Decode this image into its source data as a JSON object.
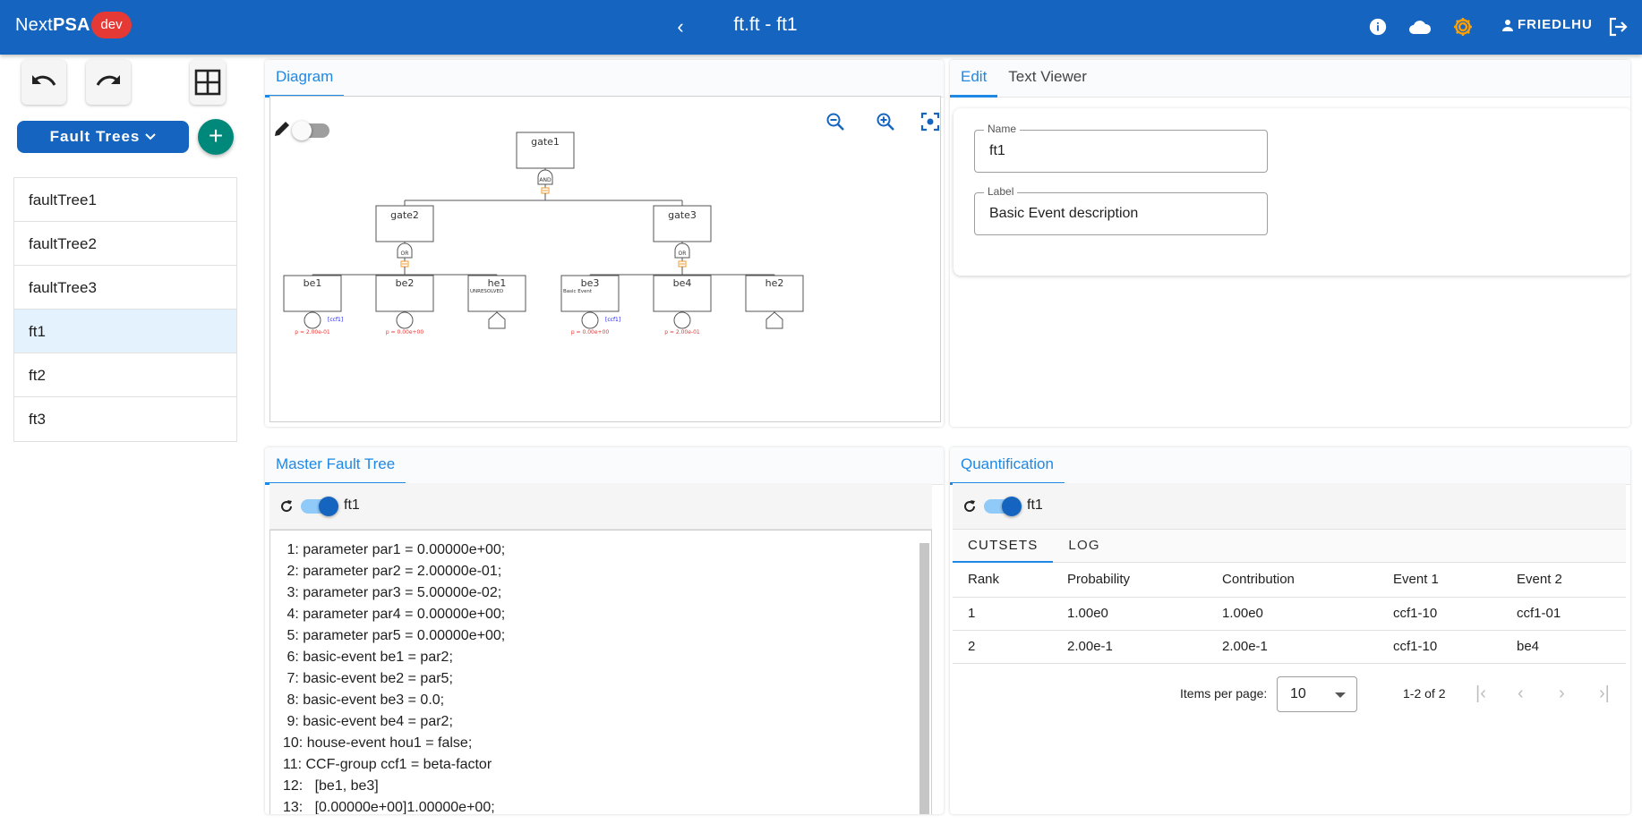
{
  "header": {
    "brand_prefix": "Next",
    "brand_suffix": "PSA",
    "env_badge": "dev",
    "title": "ft.ft - ft1",
    "user": "FRIEDLHU"
  },
  "sidebar": {
    "dropdown_label": "Fault Trees",
    "items": [
      "faultTree1",
      "faultTree2",
      "faultTree3",
      "ft1",
      "ft2",
      "ft3"
    ],
    "selected": "ft1"
  },
  "diagram_panel": {
    "tab": "Diagram",
    "tree": {
      "top": {
        "name": "gate1",
        "type": "AND"
      },
      "gates": [
        {
          "name": "gate2",
          "type": "OR"
        },
        {
          "name": "gate3",
          "type": "OR"
        }
      ],
      "events": [
        {
          "name": "be1",
          "kind": "basic",
          "prob": "p = 2.00e-01",
          "tag": "[ccf1]",
          "desc": ""
        },
        {
          "name": "be2",
          "kind": "basic",
          "prob": "p = 0.00e+00",
          "tag": "",
          "desc": ""
        },
        {
          "name": "he1",
          "kind": "house",
          "prob": "",
          "tag": "",
          "desc": "UNRESOLVED"
        },
        {
          "name": "be3",
          "kind": "basic",
          "prob": "p = 0.00e+00",
          "tag": "[ccf1]",
          "desc": "Basic Event"
        },
        {
          "name": "be4",
          "kind": "basic",
          "prob": "p = 2.00e-01",
          "tag": "",
          "desc": ""
        },
        {
          "name": "he2",
          "kind": "house",
          "prob": "",
          "tag": "",
          "desc": ""
        }
      ]
    }
  },
  "edit_panel": {
    "tabs": [
      "Edit",
      "Text Viewer"
    ],
    "name_label": "Name",
    "name_value": "ft1",
    "label_label": "Label",
    "label_value": "Basic Event description"
  },
  "master_panel": {
    "tab": "Master Fault Tree",
    "toolbar_label": "ft1",
    "lines": [
      " 1: parameter par1 = 0.00000e+00;",
      " 2: parameter par2 = 2.00000e-01;",
      " 3: parameter par3 = 5.00000e-02;",
      " 4: parameter par4 = 0.00000e+00;",
      " 5: parameter par5 = 0.00000e+00;",
      " 6: basic-event be1 = par2;",
      " 7: basic-event be2 = par5;",
      " 8: basic-event be3 = 0.0;",
      " 9: basic-event be4 = par2;",
      "10: house-event hou1 = false;",
      "11: CCF-group ccf1 = beta-factor",
      "12:   [be1, be3]",
      "13:   [0.00000e+00]1.00000e+00;"
    ]
  },
  "quant_panel": {
    "tab": "Quantification",
    "toolbar_label": "ft1",
    "subtabs": [
      "CUTSETS",
      "LOG"
    ],
    "columns": [
      "Rank",
      "Probability",
      "Contribution",
      "Event 1",
      "Event 2"
    ],
    "rows": [
      [
        "1",
        "1.00e0",
        "1.00e0",
        "ccf1-10",
        "ccf1-01"
      ],
      [
        "2",
        "2.00e-1",
        "2.00e-1",
        "ccf1-10",
        "be4"
      ]
    ],
    "items_per_page_label": "Items per page:",
    "items_per_page": "10",
    "range": "1-2 of 2"
  },
  "colors": {
    "primary": "#1565c0",
    "accent": "#1e88e5",
    "badge": "#e53935",
    "add": "#00897b",
    "settings": "#ffa000",
    "probability": "#e53935",
    "ccf_tag": "#1a1aff",
    "gate_symbol": "#f29b2b"
  }
}
